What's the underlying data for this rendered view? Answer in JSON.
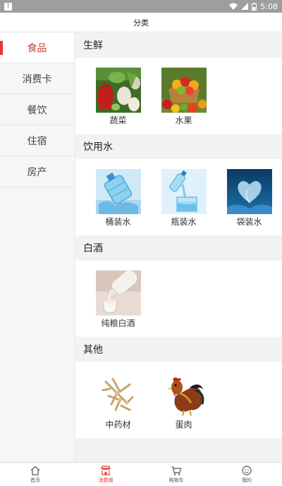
{
  "status_bar": {
    "time": "5:08",
    "battery": "8"
  },
  "header": {
    "title": "分类"
  },
  "sidebar": {
    "items": [
      {
        "label": "食品",
        "active": true
      },
      {
        "label": "消费卡",
        "active": false
      },
      {
        "label": "餐饮",
        "active": false
      },
      {
        "label": "住宿",
        "active": false
      },
      {
        "label": "房产",
        "active": false
      }
    ]
  },
  "sections": [
    {
      "title": "生鲜",
      "items": [
        {
          "label": "蔬菜",
          "icon": "vegetables-image"
        },
        {
          "label": "水果",
          "icon": "fruit-basket-image"
        }
      ]
    },
    {
      "title": "饮用水",
      "items": [
        {
          "label": "桶装水",
          "icon": "water-bottle-image"
        },
        {
          "label": "瓶装水",
          "icon": "bottled-water-image"
        },
        {
          "label": "袋装水",
          "icon": "water-heart-image"
        }
      ]
    },
    {
      "title": "白酒",
      "items": [
        {
          "label": "纯粮白酒",
          "icon": "liquor-pour-image"
        }
      ]
    },
    {
      "title": "其他",
      "items": [
        {
          "label": "中药材",
          "icon": "herbal-roots-image"
        },
        {
          "label": "蛋肉",
          "icon": "rooster-image"
        }
      ]
    }
  ],
  "tabbar": {
    "items": [
      {
        "label": "首页",
        "icon": "home-icon",
        "active": false
      },
      {
        "label": "消费城",
        "icon": "shop-icon",
        "active": true
      },
      {
        "label": "购物车",
        "icon": "cart-icon",
        "active": false
      },
      {
        "label": "我的",
        "icon": "user-face-icon",
        "active": false
      }
    ]
  },
  "colors": {
    "accent": "#e53935",
    "active_text": "#d03a2c"
  }
}
